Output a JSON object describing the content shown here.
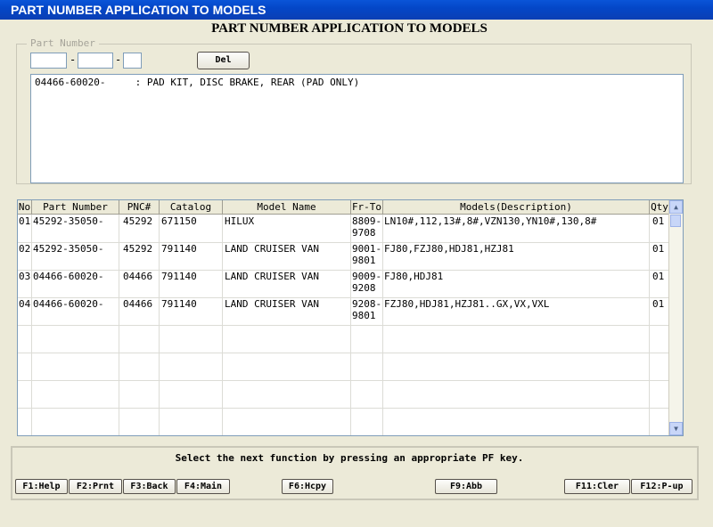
{
  "window": {
    "title": "PART NUMBER APPLICATION TO MODELS"
  },
  "heading": "PART NUMBER APPLICATION TO MODELS",
  "part_number_group": {
    "legend": "Part Number",
    "field1": "",
    "field2": "",
    "field3": "",
    "dash": "-",
    "del_label": "Del"
  },
  "description_area": {
    "text": "04466-60020-     : PAD KIT, DISC BRAKE, REAR (PAD ONLY)"
  },
  "grid": {
    "columns": [
      "No",
      "Part Number",
      "PNC#",
      "Catalog",
      "Model Name",
      "Fr-To",
      "Models(Description)",
      "Qty"
    ],
    "rows": [
      {
        "no": "01",
        "part": "45292-35050-",
        "pnc": "45292",
        "catalog": "671150",
        "model": "HILUX",
        "fr": "8809-",
        "to": "9708",
        "desc": "LN10#,112,13#,8#,VZN130,YN10#,130,8#",
        "qty": "01"
      },
      {
        "no": "02",
        "part": "45292-35050-",
        "pnc": "45292",
        "catalog": "791140",
        "model": "LAND CRUISER VAN",
        "fr": "9001-",
        "to": "9801",
        "desc": "FJ80,FZJ80,HDJ81,HZJ81",
        "qty": "01"
      },
      {
        "no": "03",
        "part": "04466-60020-",
        "pnc": "04466",
        "catalog": "791140",
        "model": "LAND CRUISER VAN",
        "fr": "9009-",
        "to": "9208",
        "desc": "FJ80,HDJ81",
        "qty": "01"
      },
      {
        "no": "04",
        "part": "04466-60020-",
        "pnc": "04466",
        "catalog": "791140",
        "model": "LAND CRUISER VAN",
        "fr": "9208-",
        "to": "9801",
        "desc": "FZJ80,HDJ81,HZJ81..GX,VX,VXL",
        "qty": "01"
      }
    ]
  },
  "scrollbar": {
    "up_glyph": "▲",
    "down_glyph": "▼"
  },
  "message": "Select the next function by pressing an appropriate PF key.",
  "function_keys": {
    "f1": "F1:Help",
    "f2": "F2:Prnt",
    "f3": "F3:Back",
    "f4": "F4:Main",
    "f6": "F6:Hcpy",
    "f9": "F9:Abb",
    "f11": "F11:Cler",
    "f12": "F12:P-up"
  }
}
